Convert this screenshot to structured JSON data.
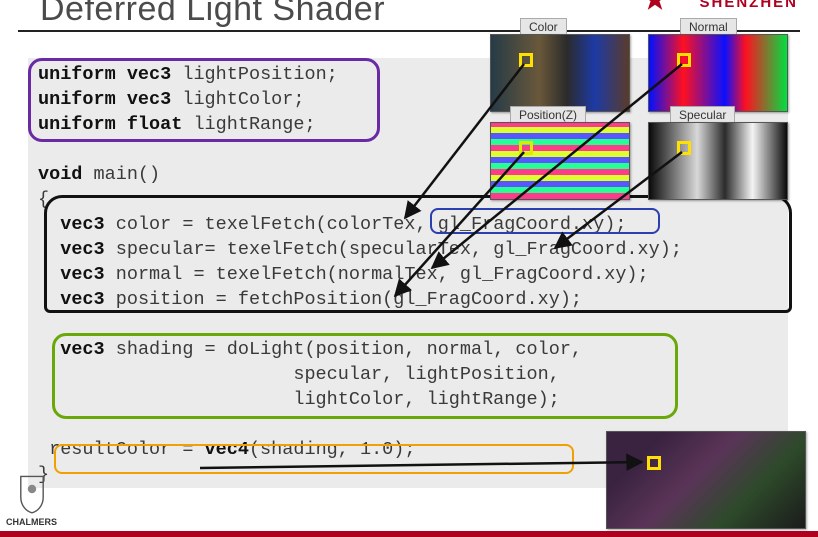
{
  "slide": {
    "title": "Deferred Light Shader",
    "brand_right": "SHENZHEN",
    "brand_left": "CHALMERS"
  },
  "code": {
    "u1_kw": "uniform",
    "u1_ty": "vec3",
    "u1_rest": " lightPosition;",
    "u2_kw": "uniform",
    "u2_ty": "vec3",
    "u2_rest": " lightColor;",
    "u3_kw": "uniform",
    "u3_ty": "float",
    "u3_rest": " lightRange;",
    "main_kw": "void",
    "main_rest": " main()",
    "brace_open": "{",
    "l1_ty": "vec3",
    "l1_rest": " color = texelFetch(colorTex, gl_FragCoord.xy);",
    "l2_ty": "vec3",
    "l2_rest": " specular= texelFetch(specularTex, gl_FragCoord.xy);",
    "l3_ty": "vec3",
    "l3_rest": " normal = texelFetch(normalTex, gl_FragCoord.xy);",
    "l4_ty": "vec3",
    "l4_rest": " position = fetchPosition(gl_FragCoord.xy);",
    "s1_ty": "vec3",
    "s1_rest": " shading = doLight(position, normal, color,",
    "s2_rest": "                       specular, lightPosition,",
    "s3_rest": "                       lightColor, lightRange);",
    "r_lhs": " resultColor = ",
    "r_ty": "vec4",
    "r_rest": "(shading, 1.0);",
    "brace_close": "}"
  },
  "thumbs": {
    "color": {
      "label": "Color"
    },
    "normal": {
      "label": "Normal"
    },
    "position": {
      "label": "Position(Z)"
    },
    "specular": {
      "label": "Specular"
    }
  }
}
